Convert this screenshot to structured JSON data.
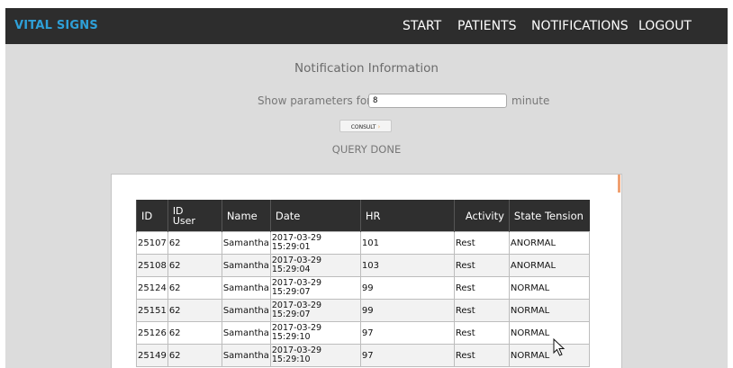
{
  "brand": "VITAL SIGNS",
  "nav": {
    "start": "START",
    "patients": "PATIENTS",
    "notifications": "NOTIFICATIONS",
    "logout": "LOGOUT"
  },
  "page_title": "Notification Information",
  "params": {
    "label": "Show parameters for:",
    "value": "8",
    "unit": "minute"
  },
  "consult_label": "CONSULT",
  "status_text": "QUERY DONE",
  "table": {
    "headers": {
      "id": "ID",
      "id_user_1": "ID",
      "id_user_2": "User",
      "name": "Name",
      "date": "Date",
      "hr": "HR",
      "activity": "Activity",
      "state": "State Tension"
    },
    "rows": [
      {
        "id": "25107",
        "user": "62",
        "name": "Samantha",
        "date1": "2017-03-29",
        "date2": "15:29:01",
        "hr": "101",
        "activity": "Rest",
        "state": "ANORMAL"
      },
      {
        "id": "25108",
        "user": "62",
        "name": "Samantha",
        "date1": "2017-03-29",
        "date2": "15:29:04",
        "hr": "103",
        "activity": "Rest",
        "state": "ANORMAL"
      },
      {
        "id": "25124",
        "user": "62",
        "name": "Samantha",
        "date1": "2017-03-29",
        "date2": "15:29:07",
        "hr": "99",
        "activity": "Rest",
        "state": "NORMAL"
      },
      {
        "id": "25151",
        "user": "62",
        "name": "Samantha",
        "date1": "2017-03-29",
        "date2": "15:29:07",
        "hr": "99",
        "activity": "Rest",
        "state": "NORMAL"
      },
      {
        "id": "25126",
        "user": "62",
        "name": "Samantha",
        "date1": "2017-03-29",
        "date2": "15:29:10",
        "hr": "97",
        "activity": "Rest",
        "state": "NORMAL"
      },
      {
        "id": "25149",
        "user": "62",
        "name": "Samantha",
        "date1": "2017-03-29",
        "date2": "15:29:10",
        "hr": "97",
        "activity": "Rest",
        "state": "NORMAL"
      }
    ]
  }
}
